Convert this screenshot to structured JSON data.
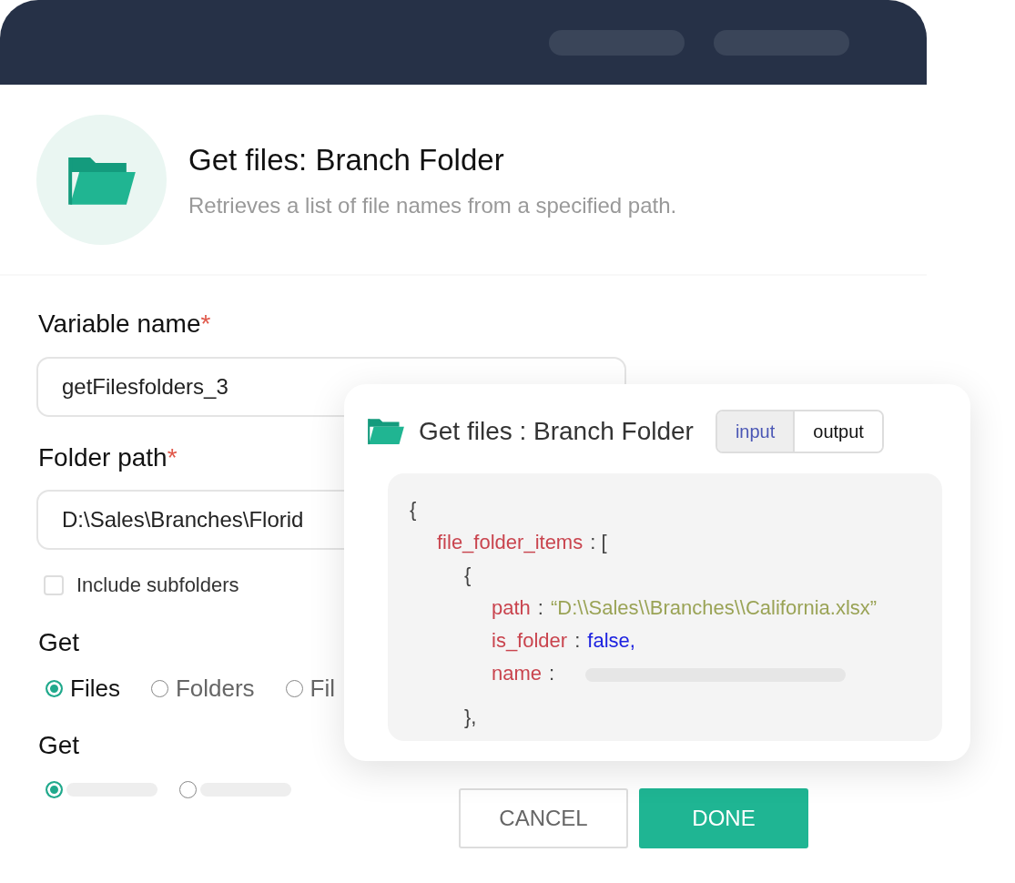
{
  "header": {
    "title": "Get files: Branch Folder",
    "subtitle": "Retrieves a list of file names from a specified path."
  },
  "fields": [
    {
      "label": "Variable name",
      "required_mark": "*",
      "value": "getFilesfolders_3"
    },
    {
      "label": "Folder path",
      "required_mark": "*",
      "value": "D:\\Sales\\Branches\\Florid"
    }
  ],
  "checkbox": {
    "label": "Include subfolders",
    "checked": false
  },
  "radio_groups": [
    {
      "label": "Get",
      "options": [
        {
          "label": "Files",
          "selected": true
        },
        {
          "label": "Folders",
          "selected": false
        },
        {
          "label": "Fil",
          "selected": false
        }
      ]
    },
    {
      "label": "Get",
      "options": [
        {
          "selected": true
        },
        {
          "selected": false
        }
      ]
    }
  ],
  "popup": {
    "title": "Get files : Branch Folder",
    "tabs": [
      {
        "label": "input",
        "selected": true
      },
      {
        "label": "output",
        "selected": false
      }
    ],
    "code": {
      "open": "{",
      "children": [
        {
          "key": "file_folder_items",
          "sep": ": [",
          "children": [
            {
              "open": "{",
              "children": [
                {
                  "key": "path",
                  "sep": ":",
                  "kind": "string",
                  "value": "“D:\\\\Sales\\\\Branches\\\\California.xlsx”"
                },
                {
                  "key": "is_folder",
                  "sep": ":",
                  "kind": "literal",
                  "value": "false,"
                },
                {
                  "key": "name",
                  "sep": ":",
                  "kind": "hidden"
                }
              ],
              "close": "},"
            }
          ]
        }
      ]
    }
  },
  "buttons": [
    {
      "label": "CANCEL",
      "kind": "secondary"
    },
    {
      "label": "DONE",
      "kind": "primary"
    }
  ]
}
